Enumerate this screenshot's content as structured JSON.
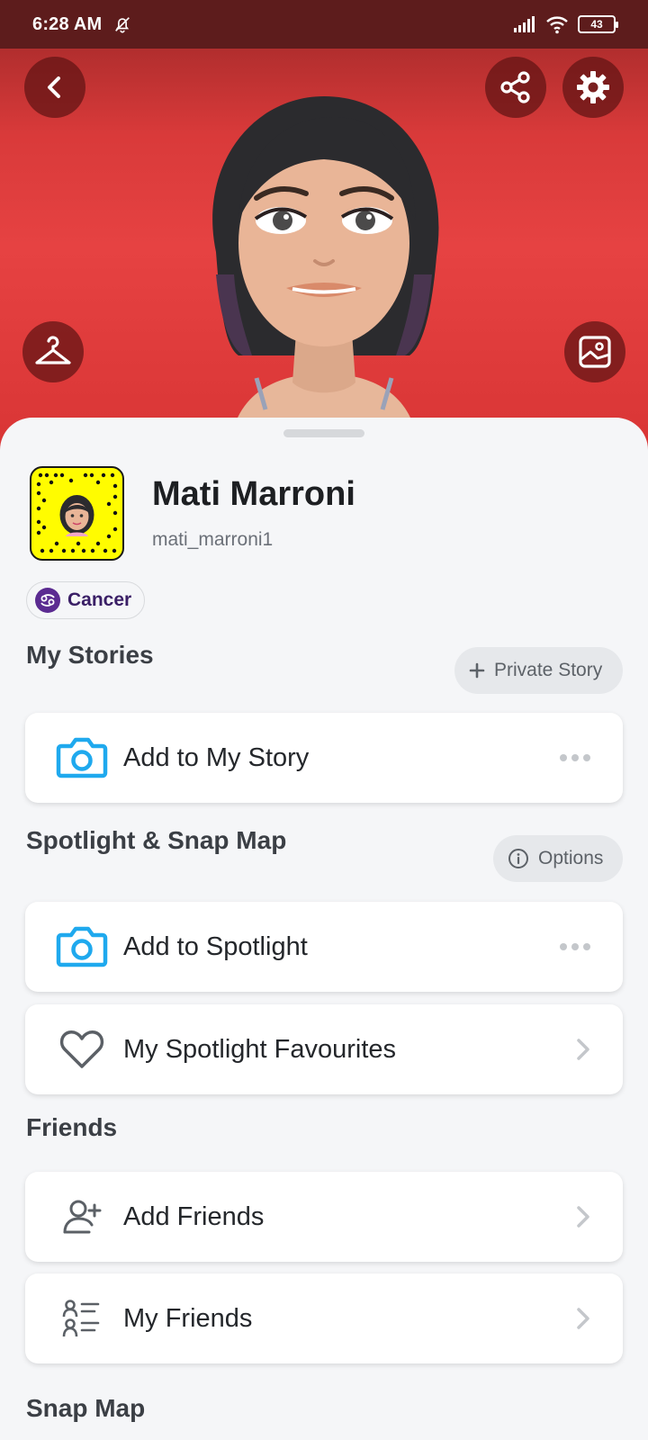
{
  "status_bar": {
    "time": "6:28 AM",
    "battery": "43"
  },
  "profile": {
    "name": "Mati Marroni",
    "username": "mati_marroni1",
    "zodiac": "Cancer"
  },
  "my_stories": {
    "title": "My Stories",
    "private_story_button": "Private Story",
    "add_story_label": "Add to My Story"
  },
  "spotlight": {
    "title": "Spotlight & Snap Map",
    "options_button": "Options",
    "add_spotlight_label": "Add to Spotlight",
    "favourites_label": "My Spotlight Favourites"
  },
  "friends": {
    "title": "Friends",
    "add_friends_label": "Add Friends",
    "my_friends_label": "My Friends"
  },
  "next_section": {
    "title": "Snap Map"
  },
  "colors": {
    "hero_red": "#e64242",
    "snapcode_yellow": "#fffc00",
    "camera_blue": "#1fa9ee",
    "zodiac_purple": "#5b2b91"
  },
  "icons": [
    "back-icon",
    "share-icon",
    "gear-icon",
    "hanger-icon",
    "photo-icon",
    "camera-icon",
    "heart-icon",
    "add-friend-icon",
    "friends-list-icon",
    "chevron-right-icon",
    "more-icon"
  ]
}
